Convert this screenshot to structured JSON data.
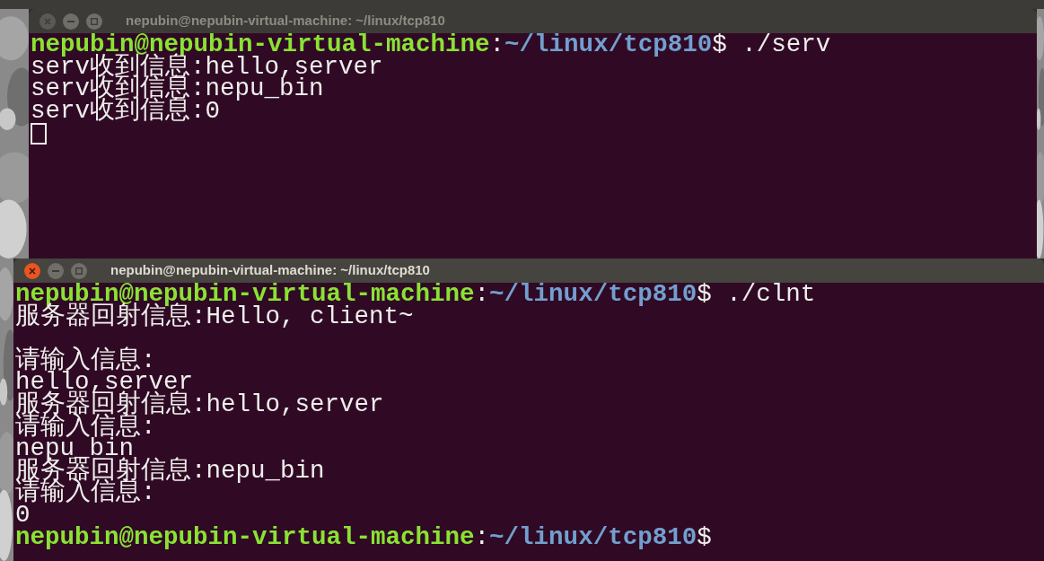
{
  "windows": [
    {
      "title": "nepubin@nepubin-virtual-machine: ~/linux/tcp810",
      "focused": false,
      "lines": [
        {
          "kind": "prompt",
          "user_host": "nepubin@nepubin-virtual-machine",
          "separator": ":",
          "path": "~/linux/tcp810",
          "symbol": "$",
          "command": " ./serv"
        },
        {
          "kind": "output",
          "text": "serv收到信息:hello,server"
        },
        {
          "kind": "output",
          "text": "serv收到信息:nepu_bin"
        },
        {
          "kind": "output",
          "text": "serv收到信息:0"
        },
        {
          "kind": "cursor"
        }
      ]
    },
    {
      "title": "nepubin@nepubin-virtual-machine: ~/linux/tcp810",
      "focused": true,
      "lines": [
        {
          "kind": "prompt",
          "user_host": "nepubin@nepubin-virtual-machine",
          "separator": ":",
          "path": "~/linux/tcp810",
          "symbol": "$",
          "command": " ./clnt"
        },
        {
          "kind": "output",
          "text": "服务器回射信息:Hello, client~"
        },
        {
          "kind": "blank"
        },
        {
          "kind": "output",
          "text": "请输入信息:"
        },
        {
          "kind": "output",
          "text": "hello,server"
        },
        {
          "kind": "output",
          "text": "服务器回射信息:hello,server"
        },
        {
          "kind": "output",
          "text": "请输入信息:"
        },
        {
          "kind": "output",
          "text": "nepu_bin"
        },
        {
          "kind": "output",
          "text": "服务器回射信息:nepu_bin"
        },
        {
          "kind": "output",
          "text": "请输入信息:"
        },
        {
          "kind": "output",
          "text": "0"
        },
        {
          "kind": "prompt",
          "user_host": "nepubin@nepubin-virtual-machine",
          "separator": ":",
          "path": "~/linux/tcp810",
          "symbol": "$"
        }
      ]
    }
  ]
}
